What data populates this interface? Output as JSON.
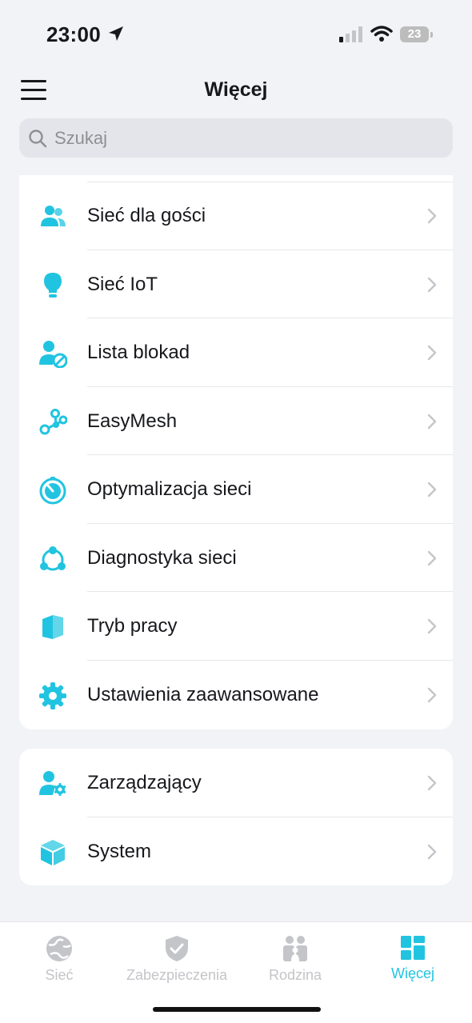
{
  "status": {
    "time": "23:00",
    "battery": "23",
    "icons": [
      "location-arrow-icon",
      "cellular-signal-icon",
      "wifi-icon",
      "battery-icon"
    ]
  },
  "header": {
    "title": "Więcej",
    "menu_icon": "hamburger-menu-icon"
  },
  "search": {
    "placeholder": "Szukaj",
    "value": ""
  },
  "menu_group_1": [
    {
      "label": "Sieć dla gości",
      "icon": "guest-users-icon"
    },
    {
      "label": "Sieć IoT",
      "icon": "lightbulb-icon"
    },
    {
      "label": "Lista blokad",
      "icon": "user-blocked-icon"
    },
    {
      "label": "EasyMesh",
      "icon": "mesh-nodes-icon"
    },
    {
      "label": "Optymalizacja sieci",
      "icon": "optimize-speed-icon"
    },
    {
      "label": "Diagnostyka sieci",
      "icon": "diagnostics-icon"
    },
    {
      "label": "Tryb pracy",
      "icon": "operation-mode-icon"
    },
    {
      "label": "Ustawienia zaawansowane",
      "icon": "gear-icon"
    }
  ],
  "menu_group_2": [
    {
      "label": "Zarządzający",
      "icon": "user-admin-icon"
    },
    {
      "label": "System",
      "icon": "box-icon"
    }
  ],
  "tabs": [
    {
      "label": "Sieć",
      "icon": "globe-icon",
      "active": false
    },
    {
      "label": "Zabezpieczenia",
      "icon": "shield-check-icon",
      "active": false
    },
    {
      "label": "Rodzina",
      "icon": "family-icon",
      "active": false
    },
    {
      "label": "Więcej",
      "icon": "grid-icon",
      "active": true
    }
  ],
  "colors": {
    "accent": "#21c4e0",
    "background": "#f2f3f7",
    "inactive": "#c4c5c9"
  }
}
